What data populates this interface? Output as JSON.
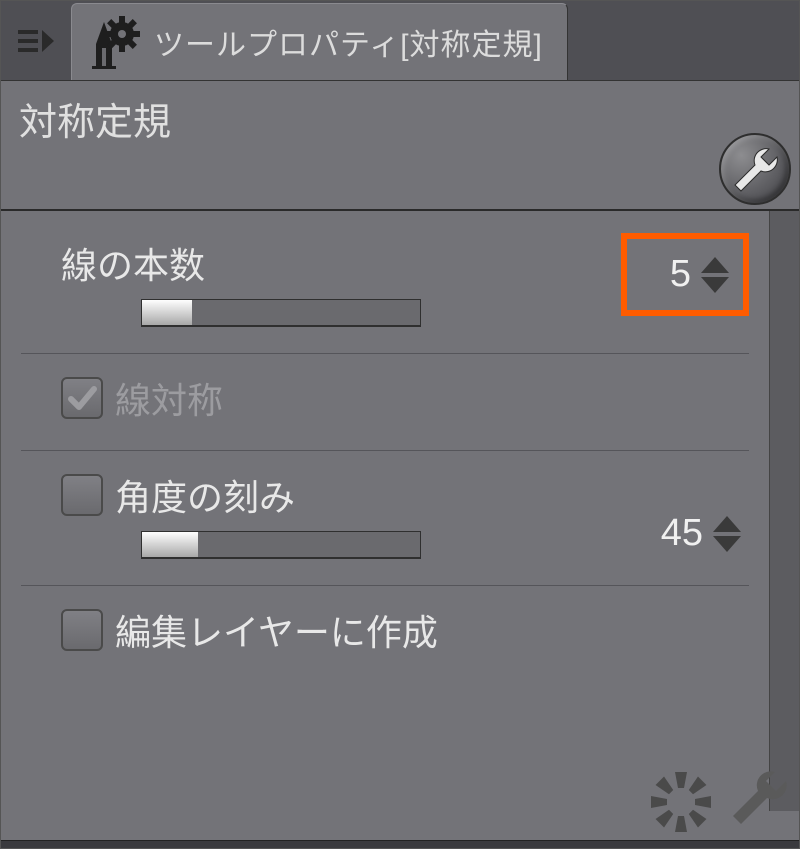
{
  "tab": {
    "title": "ツールプロパティ[対称定規]"
  },
  "header": {
    "tool_name": "対称定規"
  },
  "props": {
    "line_count": {
      "label": "線の本数",
      "value": "5",
      "slider_fill_percent": 18
    },
    "line_symmetry": {
      "label": "線対称",
      "checked": true,
      "disabled": true
    },
    "angle_step": {
      "label": "角度の刻み",
      "checked": false,
      "value": "45",
      "slider_fill_percent": 20
    },
    "create_on_edit_layer": {
      "label": "編集レイヤーに作成",
      "checked": false
    }
  }
}
